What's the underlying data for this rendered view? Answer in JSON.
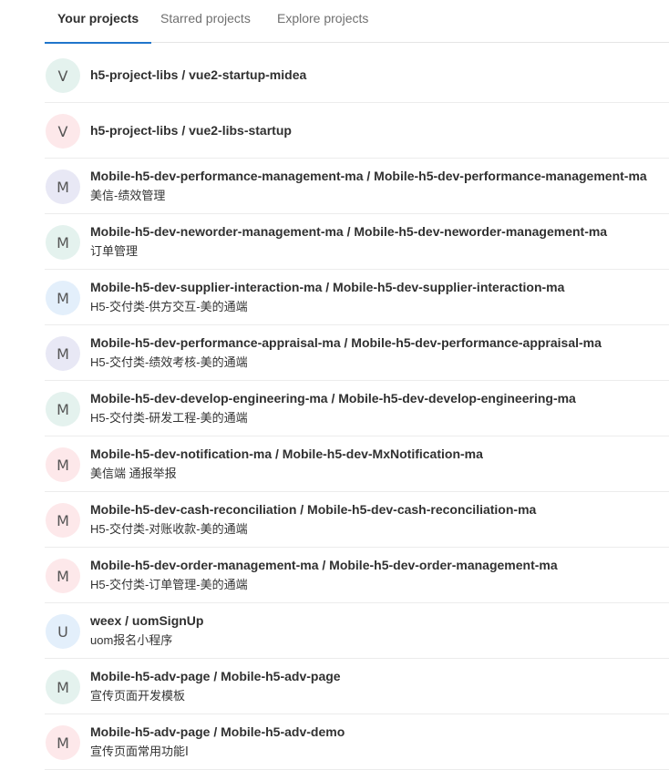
{
  "tabs": [
    {
      "label": "Your projects",
      "active": true
    },
    {
      "label": "Starred projects",
      "active": false
    },
    {
      "label": "Explore projects",
      "active": false
    }
  ],
  "avatar_colors": {
    "teal": "#e4f2ee",
    "red": "#fde8ea",
    "purple": "#e8e8f5",
    "blue": "#e3effb"
  },
  "projects": [
    {
      "initial": "V",
      "color": "teal",
      "name": "h5-project-libs / vue2-startup-midea",
      "description": ""
    },
    {
      "initial": "V",
      "color": "red",
      "name": "h5-project-libs / vue2-libs-startup",
      "description": ""
    },
    {
      "initial": "M",
      "color": "purple",
      "name": "Mobile-h5-dev-performance-management-ma / Mobile-h5-dev-performance-management-ma",
      "description": "美信-绩效管理"
    },
    {
      "initial": "M",
      "color": "teal",
      "name": "Mobile-h5-dev-neworder-management-ma / Mobile-h5-dev-neworder-management-ma",
      "description": "订单管理"
    },
    {
      "initial": "M",
      "color": "blue",
      "name": "Mobile-h5-dev-supplier-interaction-ma / Mobile-h5-dev-supplier-interaction-ma",
      "description": "H5-交付类-供方交互-美的通端"
    },
    {
      "initial": "M",
      "color": "purple",
      "name": "Mobile-h5-dev-performance-appraisal-ma / Mobile-h5-dev-performance-appraisal-ma",
      "description": "H5-交付类-绩效考核-美的通端"
    },
    {
      "initial": "M",
      "color": "teal",
      "name": "Mobile-h5-dev-develop-engineering-ma / Mobile-h5-dev-develop-engineering-ma",
      "description": "H5-交付类-研发工程-美的通端"
    },
    {
      "initial": "M",
      "color": "red",
      "name": "Mobile-h5-dev-notification-ma / Mobile-h5-dev-MxNotification-ma",
      "description": "美信端 通报举报"
    },
    {
      "initial": "M",
      "color": "red",
      "name": "Mobile-h5-dev-cash-reconciliation / Mobile-h5-dev-cash-reconciliation-ma",
      "description": "H5-交付类-对账收款-美的通端"
    },
    {
      "initial": "M",
      "color": "red",
      "name": "Mobile-h5-dev-order-management-ma / Mobile-h5-dev-order-management-ma",
      "description": "H5-交付类-订单管理-美的通端"
    },
    {
      "initial": "U",
      "color": "blue",
      "name": "weex / uomSignUp",
      "description": "uom报名小程序"
    },
    {
      "initial": "M",
      "color": "teal",
      "name": "Mobile-h5-adv-page / Mobile-h5-adv-page",
      "description": "宣传页面开发模板"
    },
    {
      "initial": "M",
      "color": "red",
      "name": "Mobile-h5-adv-page / Mobile-h5-adv-demo",
      "description": "宣传页面常用功能Ⅰ"
    }
  ]
}
